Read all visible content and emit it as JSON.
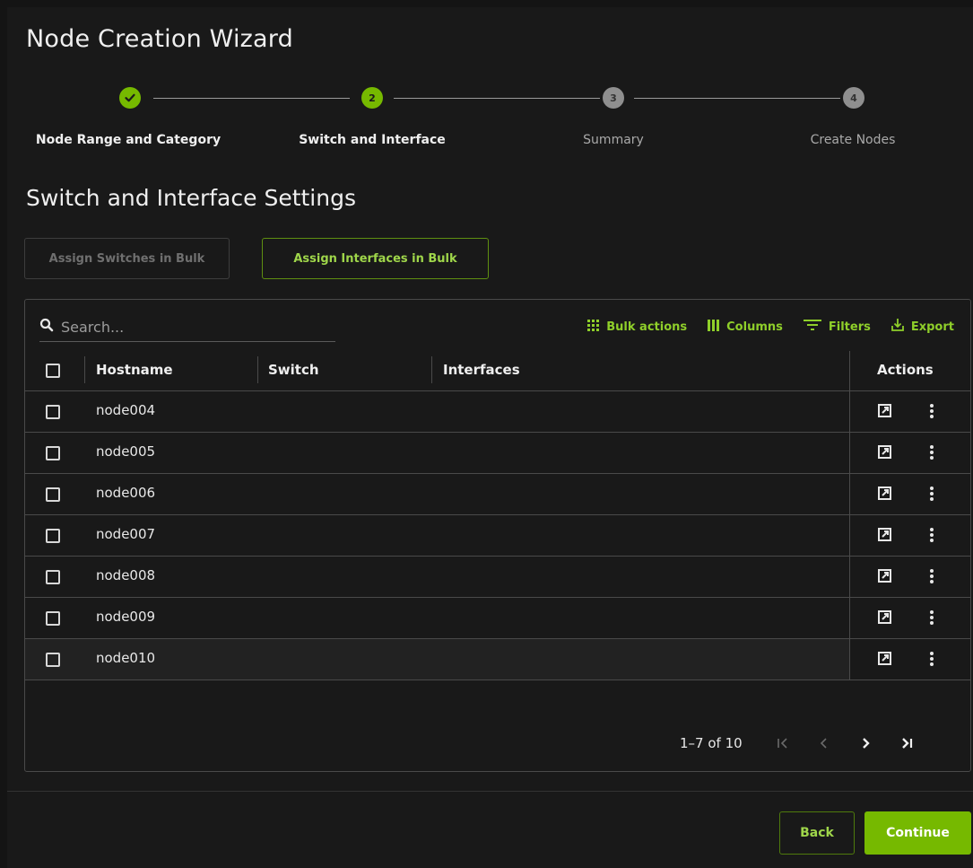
{
  "wizard": {
    "title": "Node Creation Wizard"
  },
  "steps": [
    {
      "number": "",
      "label": "Node Range and Category",
      "state": "done"
    },
    {
      "number": "2",
      "label": "Switch and Interface",
      "state": "active"
    },
    {
      "number": "3",
      "label": "Summary",
      "state": "pending"
    },
    {
      "number": "4",
      "label": "Create Nodes",
      "state": "pending"
    }
  ],
  "section": {
    "title": "Switch and Interface Settings"
  },
  "bulk": {
    "switches_label": "Assign Switches in Bulk",
    "interfaces_label": "Assign Interfaces in Bulk"
  },
  "search": {
    "placeholder": "Search..."
  },
  "toolbar": {
    "bulk_actions": "Bulk actions",
    "columns": "Columns",
    "filters": "Filters",
    "export": "Export"
  },
  "table": {
    "headers": {
      "hostname": "Hostname",
      "switch": "Switch",
      "interfaces": "Interfaces",
      "actions": "Actions"
    },
    "rows": [
      {
        "hostname": "node004",
        "switch": "",
        "interfaces": ""
      },
      {
        "hostname": "node005",
        "switch": "",
        "interfaces": ""
      },
      {
        "hostname": "node006",
        "switch": "",
        "interfaces": ""
      },
      {
        "hostname": "node007",
        "switch": "",
        "interfaces": ""
      },
      {
        "hostname": "node008",
        "switch": "",
        "interfaces": ""
      },
      {
        "hostname": "node009",
        "switch": "",
        "interfaces": ""
      },
      {
        "hostname": "node010",
        "switch": "",
        "interfaces": ""
      }
    ]
  },
  "pagination": {
    "range_text": "1–7 of 10"
  },
  "footer": {
    "back_label": "Back",
    "continue_label": "Continue"
  },
  "colors": {
    "accent": "#76b900",
    "background": "#191919",
    "border": "#4a4a4a"
  }
}
